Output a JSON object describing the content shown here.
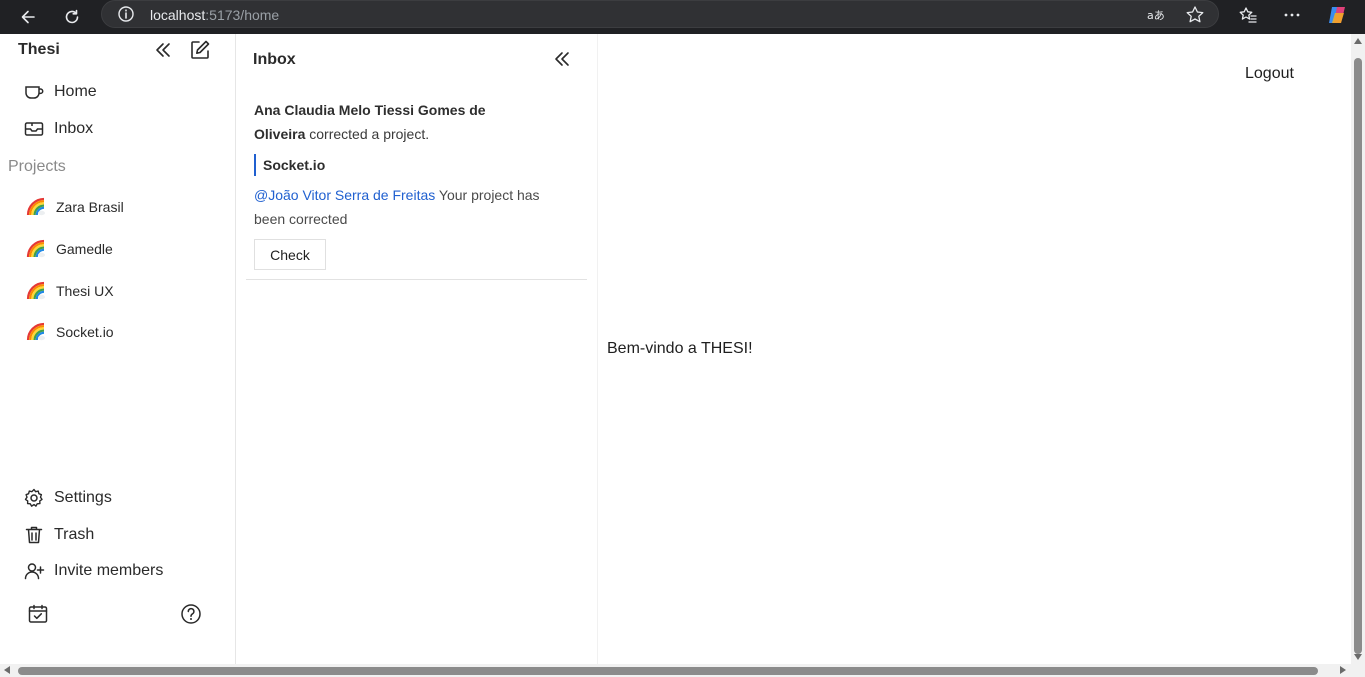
{
  "browser": {
    "url_host": "localhost",
    "url_path": ":5173/home",
    "icons": [
      "back-icon",
      "refresh-icon",
      "info-icon",
      "read-aloud-icon",
      "favorite-star-icon",
      "favorites-icon",
      "more-icon",
      "copilot-icon"
    ]
  },
  "sidebar": {
    "workspace_title": "Thesi",
    "nav": [
      {
        "label": "Home",
        "icon": "home-icon"
      },
      {
        "label": "Inbox",
        "icon": "inbox-icon"
      }
    ],
    "projects_label": "Projects",
    "projects": [
      {
        "label": "Zara Brasil",
        "icon": "rainbow-icon"
      },
      {
        "label": "Gamedle",
        "icon": "rainbow-icon"
      },
      {
        "label": "Thesi UX",
        "icon": "rainbow-icon"
      },
      {
        "label": "Socket.io",
        "icon": "rainbow-icon"
      }
    ],
    "bottom_nav": [
      {
        "label": "Settings",
        "icon": "gear-icon"
      },
      {
        "label": "Trash",
        "icon": "trash-icon"
      },
      {
        "label": "Invite members",
        "icon": "invite-user-icon"
      }
    ]
  },
  "inbox": {
    "title": "Inbox",
    "notification": {
      "author": "Ana Claudia Melo Tiessi Gomes de Oliveira",
      "action": " corrected a project.",
      "project": "Socket.io",
      "mention": "@João Vitor Serra de Freitas",
      "message": " Your project has been corrected",
      "button": "Check"
    }
  },
  "main": {
    "logout": "Logout",
    "welcome": "Bem-vindo a THESI!"
  },
  "colors": {
    "accent": "#2060d0",
    "browser_bar": "#202124"
  }
}
